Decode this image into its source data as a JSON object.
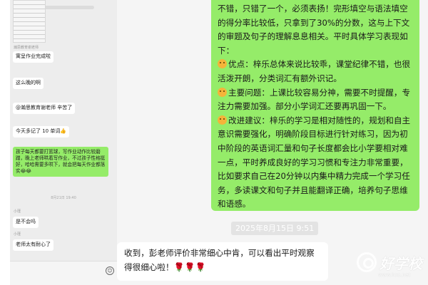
{
  "left_chat": {
    "sender_teacher": "瀚思教育谢老师",
    "sender_parent": "小瑾",
    "messages": {
      "m1": "寓呈作业完成啦",
      "m2": "这么晚的啊",
      "m3": "@瀚思教育谢老师  辛苦了",
      "m4": "今天多记了 10 单词👍",
      "m5": "孩子每天都要打篮球，写作业动作比较磨蹭，晚上老师哄着写作业，不过孩子性格挺好，哈哈需要多哄下，就会把每天作业都落实😂😂",
      "time": "8月21日 19:40",
      "m6": "是不会吗",
      "m7": "老师太有耐心了"
    },
    "emoji_icon": "smiley-icon"
  },
  "feedback": {
    "line1": "不错，只错了一个，必须表扬！完形填空与语法填空的得分率比较低，只拿到了30%的分数，这与上下文的审题及句子的理解息息相关。平时具体学习表现如下：",
    "advantage": "优点：梓乐总体来说比较乖，课堂纪律不错，也很活泼开朗，分类词汇有额外识记。",
    "problem": "主要问题：上课比较容易分神，需要不时提醒，专注力需要加强。部分小学词汇还要再巩固一下。",
    "suggestion": "改进建议：梓乐的学习是相对随性的，规划和自主意识需要强化，明确阶段目标进行针对练习，因为初中阶段的英语词汇量和句子长度都会比小学要相对难一点，平时养成良好的学习习惯和专注力非常重要，比如要求自己在20分钟以内集中精力完成一个学习任务，多读课文和句子并且能翻译正确，培养句子思维和语感。"
  },
  "timestamp": "2025年8月15日 9:51",
  "reply": {
    "text": "收到，彭老师评价非常细心中肯，可以看出平时观察得很细心啦！",
    "roses": "🌹🌹🌹"
  },
  "watermark": {
    "text": "好学校",
    "url": "www.hxx.net"
  },
  "colors": {
    "bubble_green": "#95ec69",
    "chat_bg": "#f5f5f5",
    "emoji_orange": "#f4b43a"
  }
}
